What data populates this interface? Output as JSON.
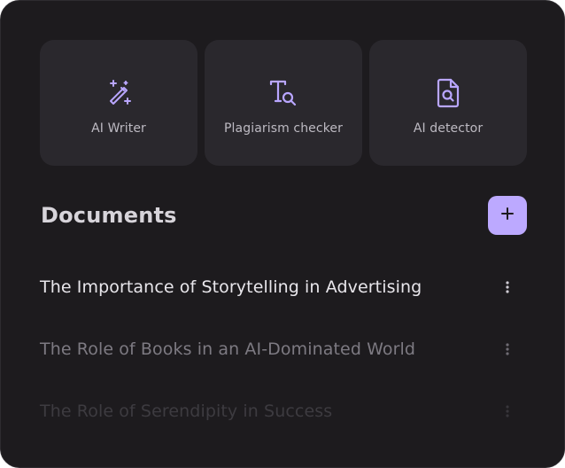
{
  "tools": [
    {
      "label": "AI Writer",
      "icon": "magic-wand-icon"
    },
    {
      "label": "Plagiarism checker",
      "icon": "text-search-icon"
    },
    {
      "label": "AI detector",
      "icon": "file-search-icon"
    }
  ],
  "documents": {
    "title": "Documents",
    "add_icon": "plus-icon",
    "items": [
      {
        "name": "The Importance of Storytelling in Advertising"
      },
      {
        "name": "The Role of Books in an AI-Dominated World"
      },
      {
        "name": "The Role of Serendipity in Success"
      }
    ]
  },
  "colors": {
    "background": "#1d1b1e",
    "card": "#2a282d",
    "accent": "#bca9ff",
    "icon": "#b9a6ff"
  }
}
